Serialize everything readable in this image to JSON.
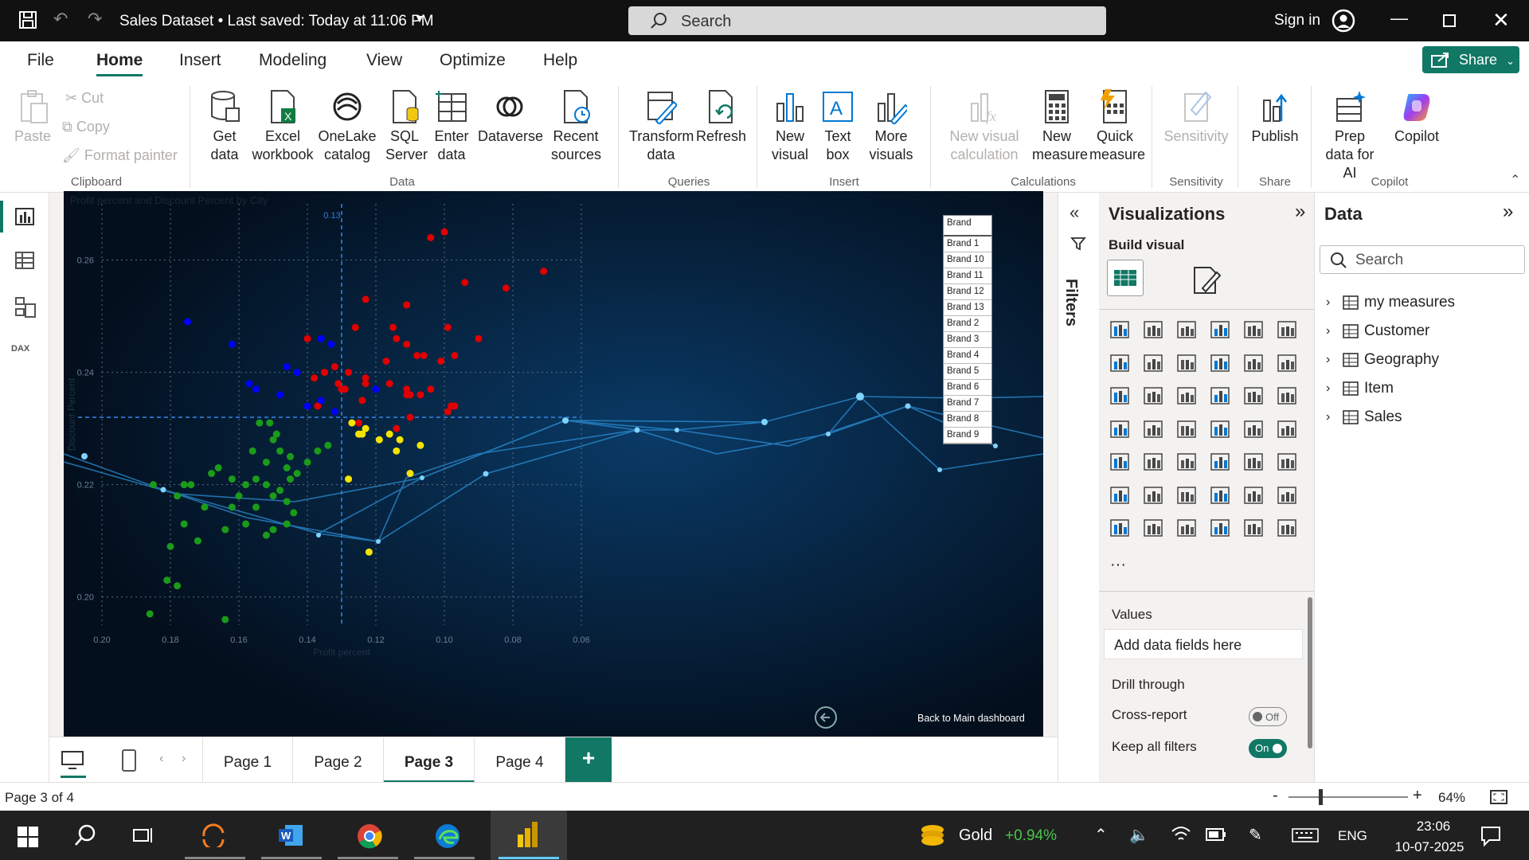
{
  "titlebar": {
    "title": "Sales Dataset • Last saved: Today at 11:06 PM",
    "search_placeholder": "Search",
    "signin": "Sign in"
  },
  "menu": {
    "tabs": [
      "File",
      "Home",
      "Insert",
      "Modeling",
      "View",
      "Optimize",
      "Help"
    ],
    "share": "Share"
  },
  "ribbon": {
    "clipboard": {
      "paste": "Paste",
      "cut": "Cut",
      "copy": "Copy",
      "format_painter": "Format painter",
      "group": "Clipboard"
    },
    "data": {
      "get_data": "Get data",
      "excel": "Excel workbook",
      "onelake": "OneLake catalog",
      "sql": "SQL Server",
      "enter": "Enter data",
      "dataverse": "Dataverse",
      "recent": "Recent sources",
      "group": "Data"
    },
    "queries": {
      "transform": "Transform data",
      "refresh": "Refresh",
      "group": "Queries"
    },
    "insert": {
      "new_visual": "New visual",
      "text_box": "Text box",
      "more_visuals": "More visuals",
      "group": "Insert"
    },
    "calculations": {
      "new_visual_calc": "New visual calculation",
      "new_measure": "New measure",
      "quick_measure": "Quick measure",
      "group": "Calculations"
    },
    "sensitivity": {
      "label": "Sensitivity",
      "group": "Sensitivity"
    },
    "share": {
      "publish": "Publish",
      "group": "Share"
    },
    "copilot": {
      "prep": "Prep data for AI",
      "copilot": "Copilot",
      "group": "Copilot"
    }
  },
  "report": {
    "title": "Profit percent and Discount Percent by City",
    "back_label": "Back to Main dashboard",
    "legend_title": "Brand",
    "legend": [
      "Brand 1",
      "Brand 10",
      "Brand 11",
      "Brand 12",
      "Brand 13",
      "Brand 2",
      "Brand 3",
      "Brand 4",
      "Brand 5",
      "Brand 6",
      "Brand 7",
      "Brand 8",
      "Brand 9"
    ],
    "ref_label": "0.13"
  },
  "chart_data": {
    "type": "scatter",
    "title": "Profit percent and Discount Percent by City",
    "xlabel": "Profit percent",
    "ylabel": "Discount Percent",
    "xlim": [
      0.2,
      0.06
    ],
    "ylim": [
      0.195,
      0.27
    ],
    "x_ticks": [
      "0.20",
      "0.18",
      "0.16",
      "0.14",
      "0.12",
      "0.10",
      "0.08",
      "0.06"
    ],
    "y_ticks": [
      "0.26",
      "0.24",
      "0.22",
      "0.20"
    ],
    "reference_lines": {
      "x": 0.13,
      "y": 0.232
    },
    "series": [
      {
        "name": "red",
        "color": "#e00000",
        "points": [
          [
            0.104,
            0.264
          ],
          [
            0.1,
            0.265
          ],
          [
            0.071,
            0.258
          ],
          [
            0.094,
            0.256
          ],
          [
            0.082,
            0.255
          ],
          [
            0.111,
            0.252
          ],
          [
            0.123,
            0.253
          ],
          [
            0.099,
            0.248
          ],
          [
            0.115,
            0.248
          ],
          [
            0.111,
            0.245
          ],
          [
            0.126,
            0.248
          ],
          [
            0.114,
            0.246
          ],
          [
            0.14,
            0.246
          ],
          [
            0.117,
            0.242
          ],
          [
            0.106,
            0.243
          ],
          [
            0.108,
            0.243
          ],
          [
            0.09,
            0.246
          ],
          [
            0.123,
            0.239
          ],
          [
            0.129,
            0.237
          ],
          [
            0.101,
            0.242
          ],
          [
            0.097,
            0.243
          ],
          [
            0.138,
            0.239
          ],
          [
            0.123,
            0.238
          ],
          [
            0.128,
            0.24
          ],
          [
            0.131,
            0.238
          ],
          [
            0.116,
            0.238
          ],
          [
            0.111,
            0.236
          ],
          [
            0.11,
            0.236
          ],
          [
            0.107,
            0.236
          ],
          [
            0.111,
            0.237
          ],
          [
            0.104,
            0.237
          ],
          [
            0.132,
            0.241
          ],
          [
            0.13,
            0.237
          ],
          [
            0.124,
            0.235
          ],
          [
            0.098,
            0.234
          ],
          [
            0.099,
            0.233
          ],
          [
            0.11,
            0.232
          ],
          [
            0.125,
            0.231
          ],
          [
            0.114,
            0.23
          ],
          [
            0.097,
            0.234
          ],
          [
            0.137,
            0.234
          ],
          [
            0.135,
            0.24
          ]
        ]
      },
      {
        "name": "blue",
        "color": "#0000ff",
        "points": [
          [
            0.136,
            0.246
          ],
          [
            0.133,
            0.245
          ],
          [
            0.175,
            0.249
          ],
          [
            0.162,
            0.245
          ],
          [
            0.146,
            0.241
          ],
          [
            0.143,
            0.24
          ],
          [
            0.157,
            0.238
          ],
          [
            0.155,
            0.237
          ],
          [
            0.136,
            0.235
          ],
          [
            0.14,
            0.234
          ],
          [
            0.148,
            0.236
          ],
          [
            0.132,
            0.233
          ],
          [
            0.12,
            0.237
          ]
        ]
      },
      {
        "name": "yellow",
        "color": "#f5e400",
        "points": [
          [
            0.127,
            0.231
          ],
          [
            0.123,
            0.23
          ],
          [
            0.116,
            0.229
          ],
          [
            0.119,
            0.228
          ],
          [
            0.113,
            0.228
          ],
          [
            0.107,
            0.227
          ],
          [
            0.114,
            0.226
          ],
          [
            0.125,
            0.229
          ],
          [
            0.124,
            0.229
          ],
          [
            0.128,
            0.221
          ],
          [
            0.11,
            0.222
          ],
          [
            0.122,
            0.208
          ]
        ]
      },
      {
        "name": "green",
        "color": "#1a9b1a",
        "points": [
          [
            0.154,
            0.231
          ],
          [
            0.151,
            0.231
          ],
          [
            0.149,
            0.229
          ],
          [
            0.15,
            0.228
          ],
          [
            0.148,
            0.226
          ],
          [
            0.145,
            0.225
          ],
          [
            0.14,
            0.224
          ],
          [
            0.137,
            0.226
          ],
          [
            0.134,
            0.227
          ],
          [
            0.156,
            0.226
          ],
          [
            0.152,
            0.224
          ],
          [
            0.146,
            0.223
          ],
          [
            0.143,
            0.222
          ],
          [
            0.145,
            0.221
          ],
          [
            0.148,
            0.219
          ],
          [
            0.152,
            0.22
          ],
          [
            0.155,
            0.221
          ],
          [
            0.158,
            0.22
          ],
          [
            0.162,
            0.221
          ],
          [
            0.166,
            0.223
          ],
          [
            0.168,
            0.222
          ],
          [
            0.174,
            0.22
          ],
          [
            0.176,
            0.22
          ],
          [
            0.16,
            0.218
          ],
          [
            0.155,
            0.216
          ],
          [
            0.15,
            0.218
          ],
          [
            0.146,
            0.217
          ],
          [
            0.144,
            0.215
          ],
          [
            0.146,
            0.213
          ],
          [
            0.15,
            0.212
          ],
          [
            0.152,
            0.211
          ],
          [
            0.158,
            0.213
          ],
          [
            0.164,
            0.212
          ],
          [
            0.172,
            0.21
          ],
          [
            0.176,
            0.213
          ],
          [
            0.17,
            0.216
          ],
          [
            0.162,
            0.216
          ],
          [
            0.178,
            0.218
          ],
          [
            0.185,
            0.22
          ],
          [
            0.18,
            0.209
          ],
          [
            0.181,
            0.203
          ],
          [
            0.178,
            0.202
          ],
          [
            0.186,
            0.197
          ],
          [
            0.164,
            0.196
          ]
        ]
      }
    ]
  },
  "visualizations": {
    "title": "Visualizations",
    "build_visual": "Build visual",
    "values": "Values",
    "add_fields": "Add data fields here",
    "drill": "Drill through",
    "cross_report": "Cross-report",
    "cross_state": "Off",
    "keep_filters": "Keep all filters",
    "keep_state": "On",
    "more": "···"
  },
  "filters": {
    "label": "Filters"
  },
  "data": {
    "title": "Data",
    "search": "Search",
    "tables": [
      "my measures",
      "Customer",
      "Geography",
      "Item",
      "Sales"
    ]
  },
  "pages": {
    "tabs": [
      "Page 1",
      "Page 2",
      "Page 3",
      "Page 4"
    ],
    "add": "+"
  },
  "status": {
    "page": "Page 3 of 4",
    "zoom": "64%",
    "minus": "-",
    "plus": "+"
  },
  "taskbar": {
    "gold": "Gold",
    "gold_change": "+0.94%",
    "lang": "ENG",
    "time": "23:06",
    "date": "10-07-2025"
  },
  "colors": {
    "accent": "#117865",
    "report_bg": "#030f1d"
  }
}
